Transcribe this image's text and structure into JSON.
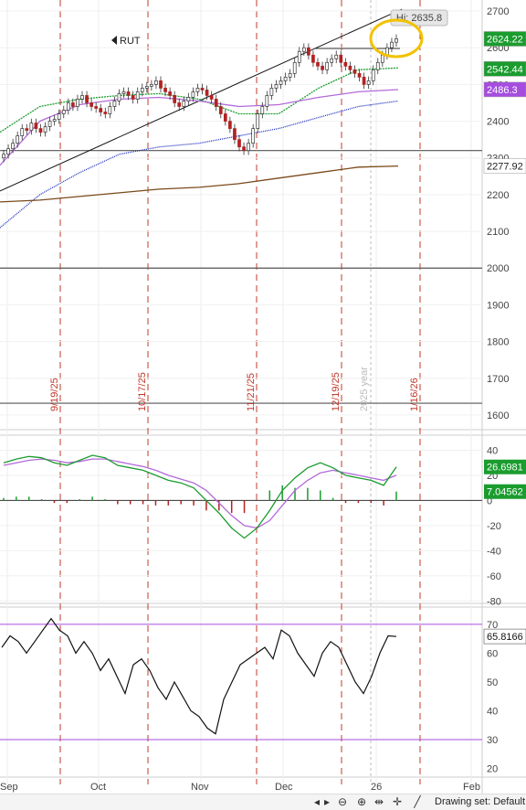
{
  "chart_data": [
    {
      "type": "candlestick",
      "symbol": "RUT",
      "x_labels": [
        "Sep",
        "Oct",
        "Nov",
        "Dec",
        "26",
        "Feb"
      ],
      "vertical_date_labels": [
        "9/19/25",
        "10/17/25",
        "11/21/25",
        "12/19/25",
        "1/16/26"
      ],
      "year_label": "2025 year",
      "yticks": [
        1600,
        1700,
        1800,
        1900,
        2000,
        2100,
        2200,
        2300,
        2400,
        2500,
        2600,
        2700
      ],
      "ylim": [
        1560,
        2730
      ],
      "horizontal_levels": [
        2000,
        1632,
        2320
      ],
      "hi_label": "Hi: 2635.8",
      "price_tags": [
        {
          "value": "2624.22",
          "color": "#1a9c2e"
        },
        {
          "value": "2542.44",
          "color": "#1a9c2e"
        },
        {
          "value": "2486.3",
          "color": "#a64de0"
        },
        {
          "value": "2277.92",
          "color": "#ffffff",
          "text_color": "#222222"
        }
      ],
      "moving_averages": [
        {
          "name": "short",
          "color": "#1a9c2e",
          "values": [
            2370,
            2440,
            2460,
            2470,
            2475,
            2460,
            2420,
            2420,
            2490,
            2540,
            2545
          ]
        },
        {
          "name": "mid",
          "color": "#b36ad9",
          "values": [
            2280,
            2400,
            2445,
            2460,
            2465,
            2455,
            2440,
            2445,
            2465,
            2480,
            2486
          ]
        },
        {
          "name": "long-blue",
          "color": "#1f2fbf",
          "values": [
            2110,
            2200,
            2260,
            2310,
            2330,
            2340,
            2360,
            2380,
            2410,
            2440,
            2455
          ]
        },
        {
          "name": "long-brown",
          "color": "#7a4a1a",
          "values": [
            2180,
            2185,
            2195,
            2205,
            2215,
            2220,
            2230,
            2245,
            2260,
            2275,
            2278
          ]
        }
      ],
      "closes": [
        2310,
        2325,
        2340,
        2360,
        2380,
        2375,
        2395,
        2380,
        2370,
        2385,
        2400,
        2405,
        2420,
        2430,
        2450,
        2440,
        2460,
        2470,
        2450,
        2440,
        2435,
        2425,
        2420,
        2440,
        2455,
        2475,
        2480,
        2470,
        2460,
        2480,
        2490,
        2495,
        2500,
        2510,
        2490,
        2480,
        2470,
        2450,
        2440,
        2455,
        2465,
        2480,
        2490,
        2485,
        2470,
        2460,
        2440,
        2420,
        2400,
        2380,
        2350,
        2330,
        2320,
        2340,
        2380,
        2420,
        2440,
        2470,
        2490,
        2500,
        2510,
        2520,
        2530,
        2560,
        2590,
        2600,
        2580,
        2560,
        2550,
        2540,
        2560,
        2570,
        2580,
        2560,
        2550,
        2540,
        2530,
        2520,
        2500,
        2510,
        2540,
        2560,
        2580,
        2600,
        2615,
        2624.22
      ]
    },
    {
      "type": "line",
      "indicator": "oscillator",
      "yticks": [
        40,
        20,
        0,
        -20,
        -40,
        -60,
        -80
      ],
      "ylim": [
        -82,
        52
      ],
      "tags": [
        {
          "value": "26.6981",
          "color": "#1a9c2e"
        },
        {
          "value": "7.04562",
          "color": "#1a9c2e"
        }
      ],
      "fast_line": [
        30,
        33,
        35,
        34,
        30,
        28,
        32,
        36,
        34,
        28,
        26,
        24,
        20,
        16,
        14,
        10,
        0,
        -10,
        -22,
        -30,
        -22,
        -8,
        8,
        18,
        26,
        30,
        26,
        20,
        18,
        16,
        12,
        26.7
      ],
      "slow_line": [
        28,
        30,
        32,
        33,
        32,
        30,
        31,
        33,
        33,
        31,
        29,
        27,
        24,
        20,
        17,
        14,
        8,
        -2,
        -12,
        -20,
        -22,
        -16,
        -4,
        8,
        16,
        22,
        24,
        22,
        20,
        18,
        16,
        20
      ],
      "histogram": [
        2,
        3,
        3,
        1,
        -2,
        -2,
        1,
        3,
        1,
        -3,
        -3,
        -3,
        -4,
        -4,
        -3,
        -4,
        -8,
        -8,
        -10,
        -10,
        0,
        8,
        12,
        10,
        10,
        8,
        2,
        -2,
        -2,
        -2,
        -4,
        7.05
      ]
    },
    {
      "type": "line",
      "indicator": "RSI",
      "yticks": [
        70,
        60,
        50,
        40,
        30,
        20
      ],
      "ylim": [
        17,
        76
      ],
      "levels": [
        70,
        30
      ],
      "tag": {
        "value": "65.8166",
        "color": "#ffffff"
      },
      "values": [
        62,
        66,
        64,
        60,
        64,
        68,
        72,
        68,
        66,
        60,
        64,
        60,
        54,
        58,
        52,
        46,
        56,
        58,
        54,
        48,
        44,
        50,
        45,
        40,
        38,
        34,
        32,
        44,
        50,
        56,
        58,
        60,
        62,
        58,
        68,
        66,
        60,
        56,
        52,
        60,
        64,
        62,
        56,
        50,
        46,
        52,
        60,
        66,
        65.8
      ]
    }
  ],
  "toolbar": {
    "drawing_set_label": "Drawing set: Default"
  }
}
